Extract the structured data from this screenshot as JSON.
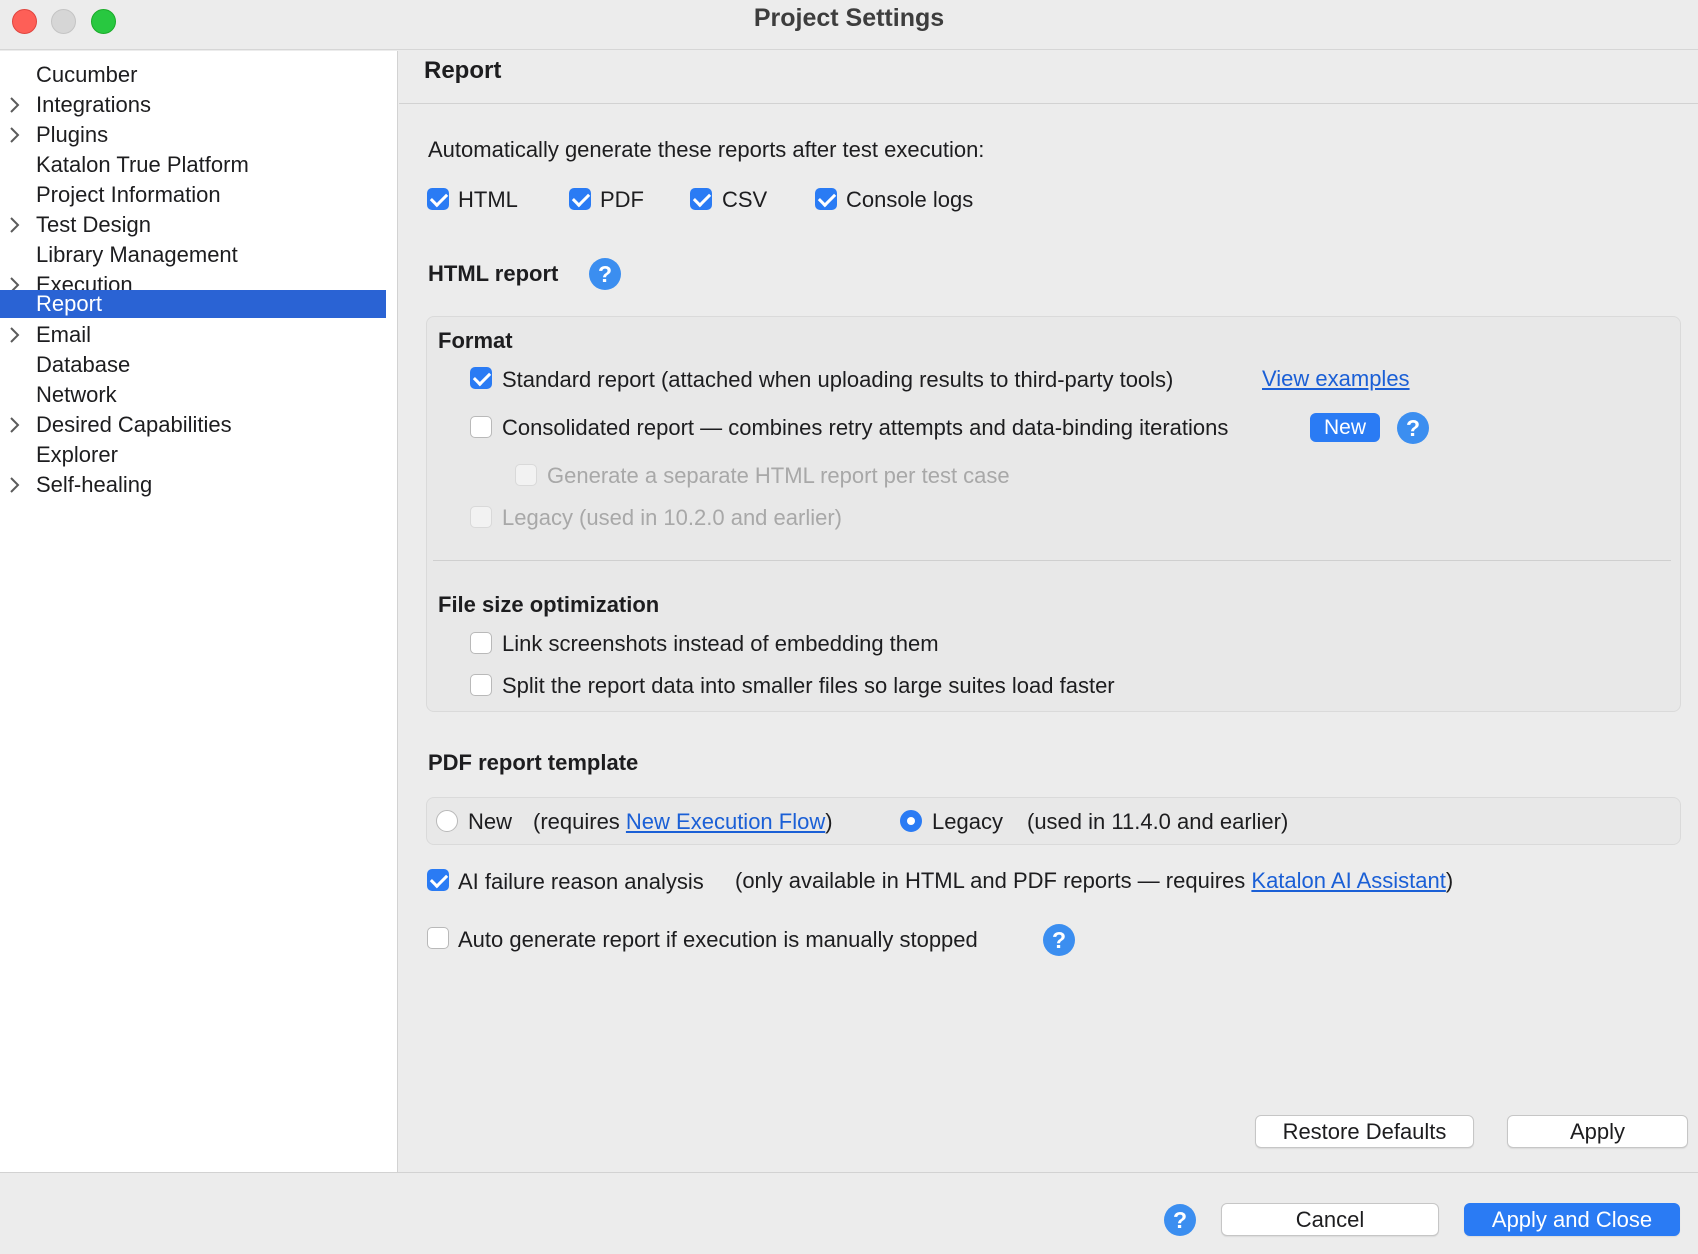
{
  "window": {
    "title": "Project Settings"
  },
  "sidebar": {
    "items": [
      {
        "label": "Cucumber",
        "expandable": false,
        "selected": false
      },
      {
        "label": "Integrations",
        "expandable": true,
        "selected": false
      },
      {
        "label": "Plugins",
        "expandable": true,
        "selected": false
      },
      {
        "label": "Katalon True Platform",
        "expandable": false,
        "selected": false
      },
      {
        "label": "Project Information",
        "expandable": false,
        "selected": false
      },
      {
        "label": "Test Design",
        "expandable": true,
        "selected": false
      },
      {
        "label": "Library Management",
        "expandable": false,
        "selected": false
      },
      {
        "label": "Execution",
        "expandable": true,
        "selected": false
      },
      {
        "label": "Report",
        "expandable": false,
        "selected": true
      },
      {
        "label": "Email",
        "expandable": true,
        "selected": false
      },
      {
        "label": "Database",
        "expandable": false,
        "selected": false
      },
      {
        "label": "Network",
        "expandable": false,
        "selected": false
      },
      {
        "label": "Desired Capabilities",
        "expandable": true,
        "selected": false
      },
      {
        "label": "Explorer",
        "expandable": false,
        "selected": false
      },
      {
        "label": "Self-healing",
        "expandable": true,
        "selected": false
      }
    ]
  },
  "content": {
    "title": "Report",
    "auto_generate": {
      "heading": "Automatically generate these reports after test execution:",
      "options": [
        {
          "label": "HTML",
          "checked": true
        },
        {
          "label": "PDF",
          "checked": true
        },
        {
          "label": "CSV",
          "checked": true
        },
        {
          "label": "Console logs",
          "checked": true
        }
      ]
    },
    "html_report": {
      "heading": "HTML report",
      "help": "?",
      "format": {
        "heading": "Format",
        "standard": {
          "label": "Standard report (attached when uploading results to third-party tools)",
          "checked": true,
          "link": "View examples"
        },
        "consolidated": {
          "label": "Consolidated report — combines retry attempts and data-binding iterations",
          "checked": false,
          "badge": "New",
          "help": "?"
        },
        "separate": {
          "label": "Generate a separate HTML report per test case",
          "checked": false,
          "disabled": true
        },
        "legacy": {
          "label": "Legacy (used in 10.2.0 and earlier)",
          "checked": false,
          "disabled": true
        }
      },
      "file_size": {
        "heading": "File size optimization",
        "link_screenshots": {
          "label": "Link screenshots instead of embedding them",
          "checked": false
        },
        "split_data": {
          "label": "Split the report data into smaller files so large suites load faster",
          "checked": false
        }
      }
    },
    "pdf_template": {
      "heading": "PDF report template",
      "new_option": {
        "label": "New",
        "note_prefix": "(requires ",
        "link": "New Execution Flow",
        "note_suffix": ")",
        "selected": false
      },
      "legacy_option": {
        "label": "Legacy",
        "note": "(used in 11.4.0 and earlier)",
        "selected": true
      }
    },
    "ai_failure": {
      "label": "AI failure reason analysis",
      "checked": true,
      "note_prefix": "(only available in HTML and PDF reports — requires ",
      "link": "Katalon AI Assistant",
      "note_suffix": ")"
    },
    "auto_stop": {
      "label": "Auto generate report if execution is manually stopped",
      "checked": false,
      "help": "?"
    },
    "buttons": {
      "restore_defaults": "Restore Defaults",
      "apply": "Apply"
    }
  },
  "footer": {
    "help": "?",
    "cancel": "Cancel",
    "apply_and_close": "Apply and Close"
  },
  "colors": {
    "accent": "#2a7bf4",
    "selection": "#2a63d4",
    "link": "#1a5fd6",
    "close": "#fe5f57",
    "maximize": "#28c840"
  }
}
